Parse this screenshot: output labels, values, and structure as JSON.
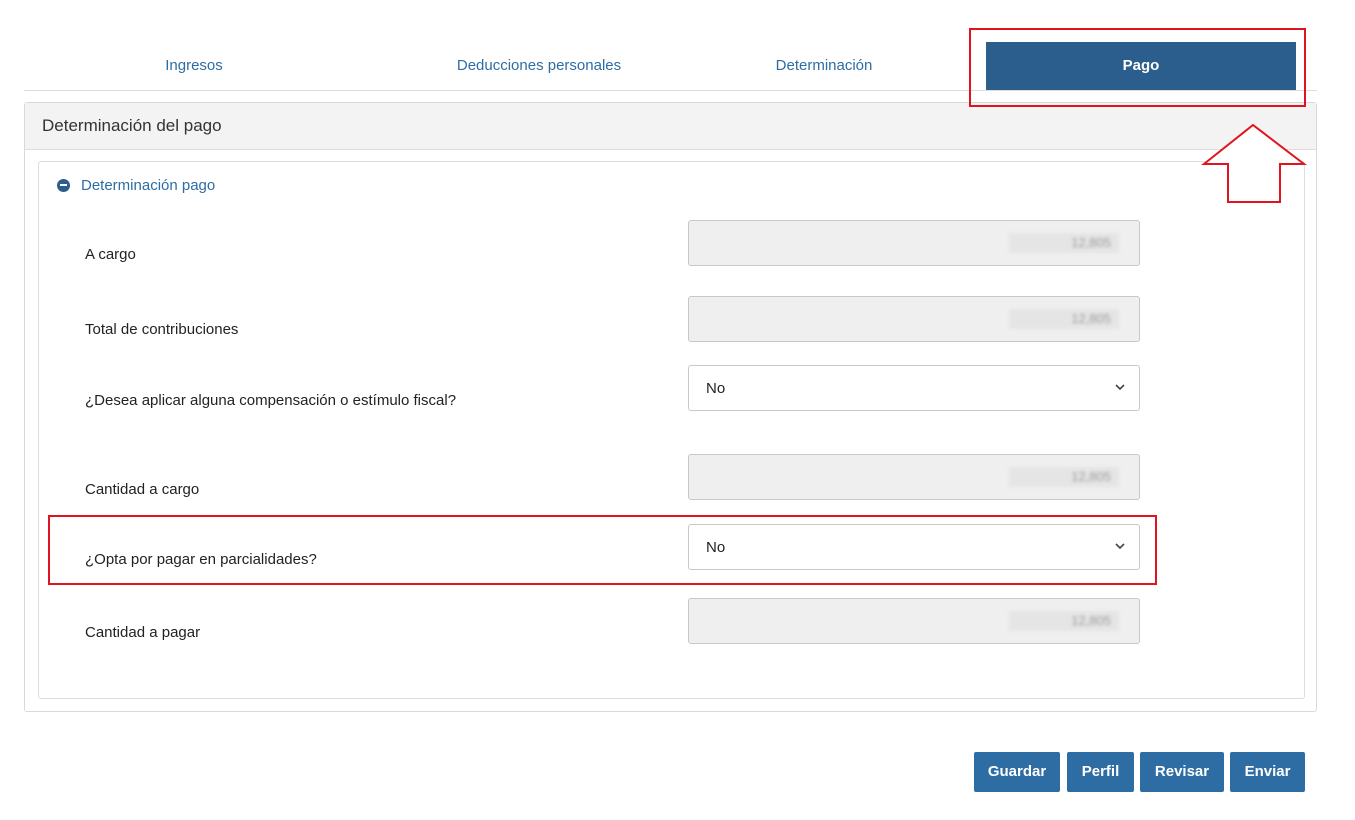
{
  "tabs": [
    {
      "label": "Ingresos"
    },
    {
      "label": "Deducciones personales"
    },
    {
      "label": "Determinación"
    },
    {
      "label": "Pago",
      "active": true
    }
  ],
  "panel": {
    "title": "Determinación del pago",
    "section_title": "Determinación pago",
    "rows": [
      {
        "label": "A cargo",
        "value": "12,805",
        "type": "readonly"
      },
      {
        "label": "Total de contribuciones",
        "value": "12,805",
        "type": "readonly"
      },
      {
        "label": "¿Desea aplicar alguna compensación o estímulo fiscal?",
        "value": "No",
        "type": "select"
      },
      {
        "label": "Cantidad a cargo",
        "value": "12,805",
        "type": "readonly"
      },
      {
        "label": "¿Opta por pagar en parcialidades?",
        "value": "No",
        "type": "select"
      },
      {
        "label": "Cantidad a pagar",
        "value": "12,805",
        "type": "readonly"
      }
    ]
  },
  "buttons": {
    "save": "Guardar",
    "profile": "Perfil",
    "review": "Revisar",
    "send": "Enviar"
  },
  "colors": {
    "primary": "#2e6da4",
    "active_tab": "#2b5e8c",
    "annotation": "#e0141e"
  },
  "icons": [
    "minus-circle-icon",
    "chevron-down-icon",
    "arrow-up-icon"
  ]
}
